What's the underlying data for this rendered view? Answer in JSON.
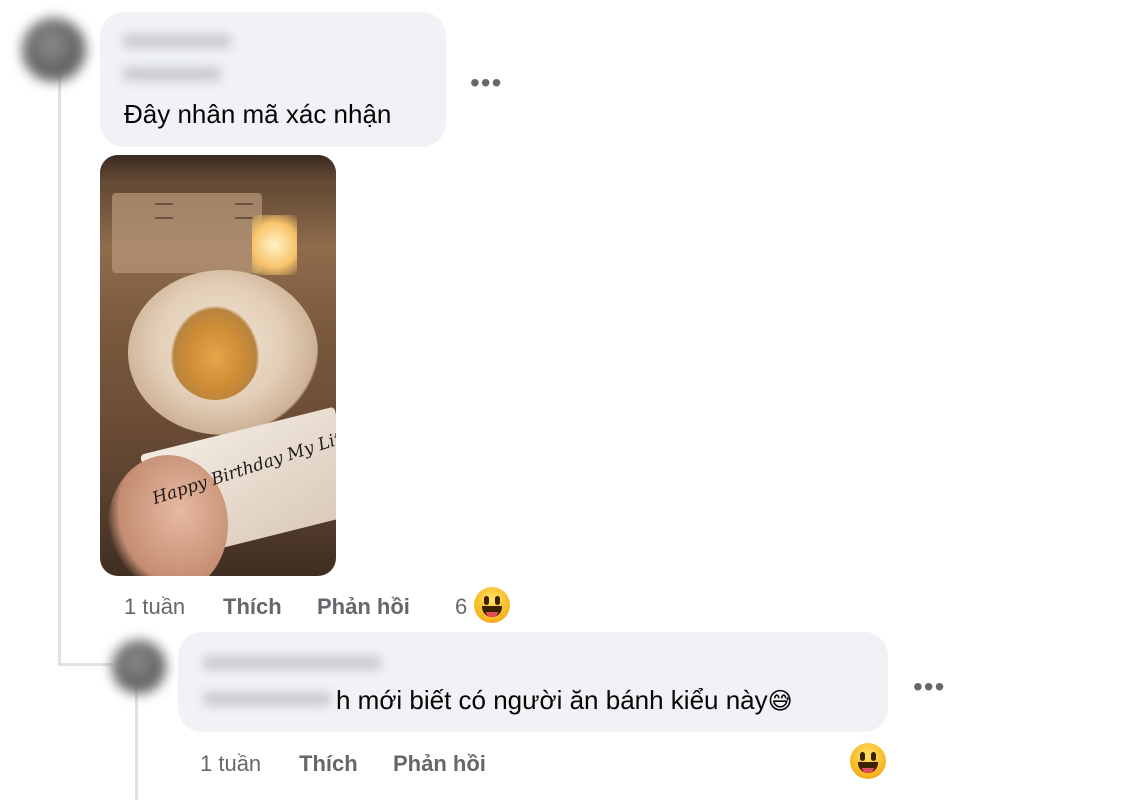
{
  "comment1": {
    "text": "Đây nhân mã xác nhận",
    "time": "1 tuần",
    "like_label": "Thích",
    "reply_label": "Phản hồi",
    "reaction_count": "6",
    "reaction_icon": "grinning-face-emoji",
    "image": {
      "caption_on_cake": "Happy Birthday My Little Princess"
    }
  },
  "comment2": {
    "text": "h mới biết có người ăn bánh kiểu này",
    "inline_emoji": "😅",
    "time": "1 tuần",
    "like_label": "Thích",
    "reply_label": "Phản hồi",
    "reaction_icon": "grinning-face-emoji"
  },
  "more_options_label": "•••",
  "colors": {
    "bubble": "#f0f2f5",
    "meta_text": "#65676b",
    "thread_line": "#dfe1e5"
  }
}
